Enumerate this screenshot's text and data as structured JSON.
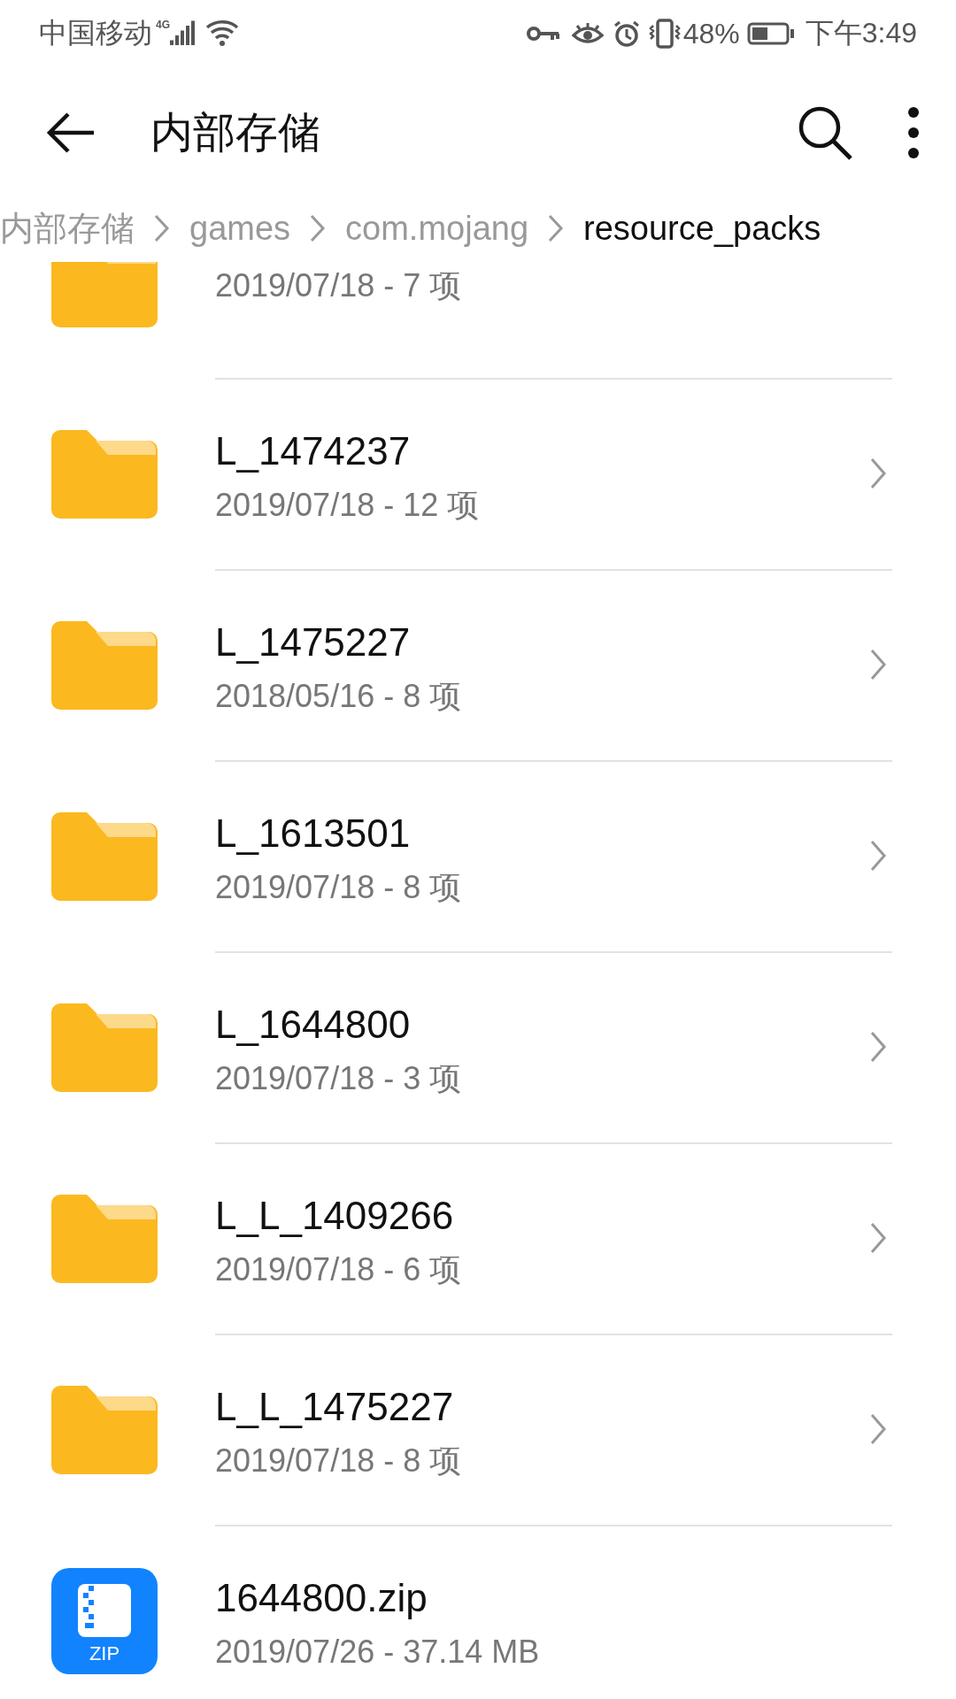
{
  "status_bar": {
    "carrier": "中国移动",
    "network": "4G",
    "battery": "48%",
    "time": "下午3:49"
  },
  "header": {
    "title": "内部存储"
  },
  "breadcrumb": [
    {
      "label": "内部存储",
      "selected": false
    },
    {
      "label": "games",
      "selected": false
    },
    {
      "label": "com.mojang",
      "selected": false
    },
    {
      "label": "resource_packs",
      "selected": true
    }
  ],
  "files": [
    {
      "kind": "folder",
      "meta": "2019/07/18 - 7 项"
    },
    {
      "kind": "folder",
      "name": "L_1474237",
      "meta": "2019/07/18 - 12 项"
    },
    {
      "kind": "folder",
      "name": "L_1475227",
      "meta": "2018/05/16 - 8 项"
    },
    {
      "kind": "folder",
      "name": "L_1613501",
      "meta": "2019/07/18 - 8 项"
    },
    {
      "kind": "folder",
      "name": "L_1644800",
      "meta": "2019/07/18 - 3 项"
    },
    {
      "kind": "folder",
      "name": "L_L_1409266",
      "meta": "2019/07/18 - 6 项"
    },
    {
      "kind": "folder",
      "name": "L_L_1475227",
      "meta": "2019/07/18 - 8 项"
    },
    {
      "kind": "zip",
      "name": "1644800.zip",
      "meta": "2019/07/26 - 37.14 MB",
      "badge": "ZIP"
    }
  ]
}
